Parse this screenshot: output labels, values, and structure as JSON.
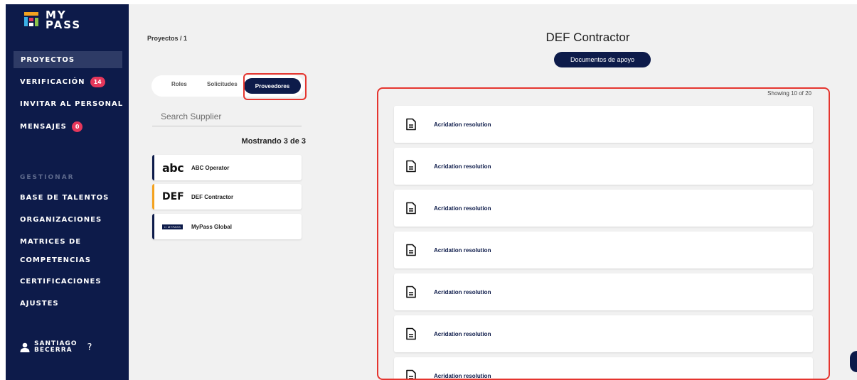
{
  "brand": {
    "line1": "MY",
    "line2": "PASS",
    "colors": [
      "#f4a21f",
      "#e5375b",
      "#3bb0e6",
      "#8bc34a"
    ]
  },
  "sidebar": {
    "items": [
      {
        "label": "PROYECTOS",
        "active": true
      },
      {
        "label": "VERIFICACIÓN",
        "badge": "14"
      },
      {
        "label": "INVITAR AL PERSONAL"
      },
      {
        "label": "MENSAJES",
        "badge": "0"
      }
    ],
    "section_label": "GESTIONAR",
    "manage_items": [
      {
        "label": "BASE DE TALENTOS"
      },
      {
        "label": "ORGANIZACIONES"
      },
      {
        "label": "MATRICES DE"
      },
      {
        "label": "COMPETENCIAS"
      },
      {
        "label": "CERTIFICACIONES"
      },
      {
        "label": "AJUSTES"
      }
    ],
    "user": {
      "first": "SANTIAGO",
      "last": "BECERRA",
      "help": "?"
    }
  },
  "breadcrumb": "Proyectos  /  1",
  "tabs": {
    "roles": "Roles",
    "requests": "Solicitudes",
    "suppliers": "Proveedores"
  },
  "search": {
    "placeholder": "Search Supplier"
  },
  "count_label": "Mostrando 3 de 3",
  "suppliers": [
    {
      "logo": "abc",
      "name": "ABC Operator",
      "icon": "abc-logo"
    },
    {
      "logo": "DEF",
      "name": "DEF Contractor",
      "icon": "def-logo",
      "selected": true
    },
    {
      "logo": "MYPASS",
      "name": "MyPass Global",
      "icon": "mypass-logo"
    }
  ],
  "detail": {
    "title": "DEF Contractor",
    "docs_button": "Documentos de apoyo",
    "showing": "Showing 10 of 20",
    "documents": [
      "Acridation resolution",
      "Acridation resolution",
      "Acridation resolution",
      "Acridation resolution",
      "Acridation resolution",
      "Acridation resolution",
      "Acridation resolution"
    ]
  }
}
